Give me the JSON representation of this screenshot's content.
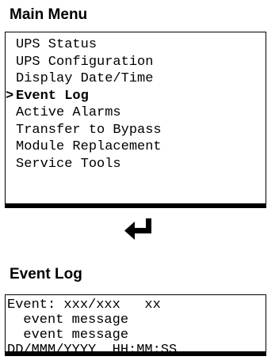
{
  "main_menu": {
    "title": "Main Menu",
    "selected_marker": ">",
    "items": [
      {
        "label": "UPS Status"
      },
      {
        "label": "UPS Configuration"
      },
      {
        "label": "Display Date/Time"
      },
      {
        "label": "Event Log"
      },
      {
        "label": "Active Alarms"
      },
      {
        "label": "Transfer to Bypass"
      },
      {
        "label": "Module Replacement"
      },
      {
        "label": "Service Tools"
      }
    ],
    "selected_index": 3
  },
  "transition_icon": "enter-arrow-icon",
  "event_log": {
    "title": "Event Log",
    "lines": [
      "Event: xxx/xxx   xx",
      "  event message",
      "  event message",
      "DD/MMM/YYYY  HH:MM:SS"
    ]
  }
}
